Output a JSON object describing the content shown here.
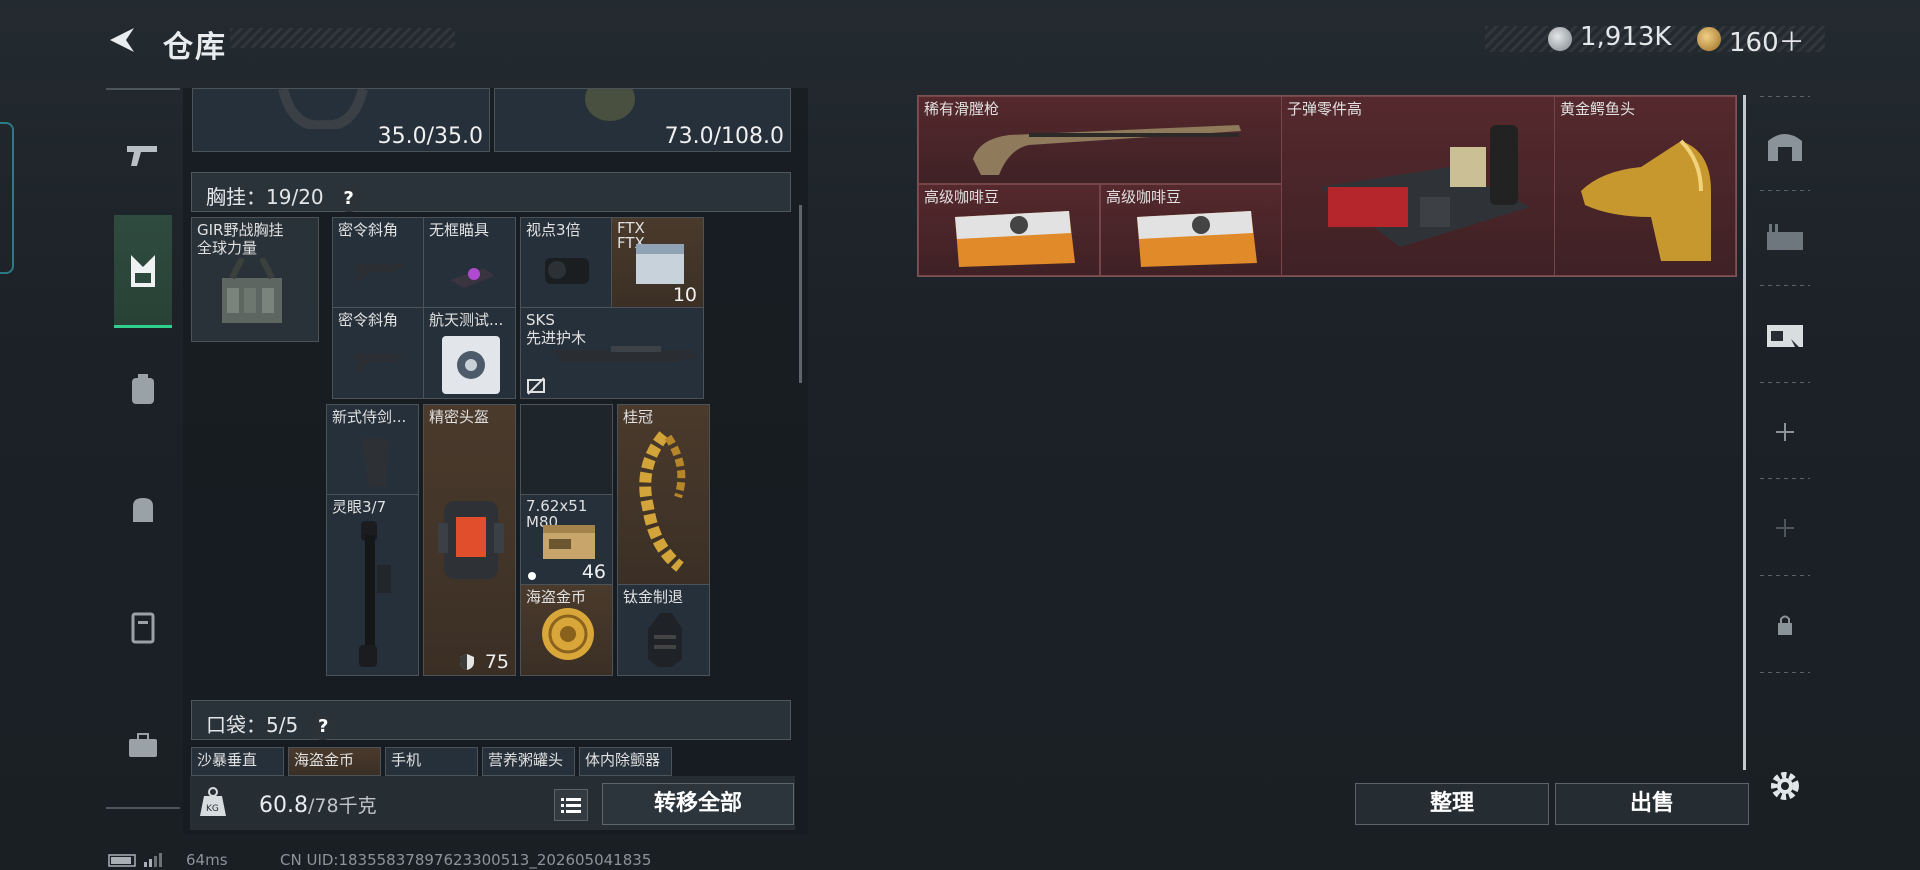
{
  "header": {
    "title": "仓库"
  },
  "currency": {
    "silver": "1,913K",
    "gold": "160＋"
  },
  "left_panel": {
    "top_values": [
      "35.0/35.0",
      "73.0/108.0"
    ],
    "chest_rig": {
      "label": "胸挂：",
      "count": "19/20",
      "help": "?"
    },
    "chest_rig_item": "GIR野战胸挂\n全球力量",
    "items": {
      "i1": "密令斜角",
      "i2": "无框瞄具",
      "i3": "视点3倍",
      "i4": "FTX\nFTX",
      "i4_count": "10",
      "i5": "密令斜角",
      "i6": "航天测试...",
      "i7": "SKS\n先进护木",
      "i8": "新式侍剑...",
      "i9": "精密头盔",
      "i9_count": "75",
      "i10": "桂冠",
      "i11": "灵眼3/7",
      "i12": "7.62x51\nM80",
      "i12_count": "46",
      "i13": "海盗金币",
      "i14": "钛金制退"
    },
    "pockets": {
      "label": "口袋：",
      "count": "5/5",
      "help": "?"
    },
    "pocket_items": [
      "沙暴垂直",
      "海盗金币",
      "手机",
      "营养粥罐头",
      "体内除颤器"
    ],
    "weight_value": "60.8",
    "weight_max": "/78千克",
    "transfer_all": "转移全部"
  },
  "stash": {
    "items": [
      "稀有滑膛枪",
      "子弹零件高",
      "黄金鳄鱼头",
      "高级咖啡豆",
      "高级咖啡豆"
    ]
  },
  "buttons": {
    "organize": "整理",
    "sell": "出售"
  },
  "status_bar": {
    "ping": "64ms",
    "uid": "CN UID:18355837897623300513_202605041835"
  },
  "colors": {
    "accent": "#2fcf8e",
    "rare_red": "#55292d",
    "gold": "#d2a43a"
  }
}
